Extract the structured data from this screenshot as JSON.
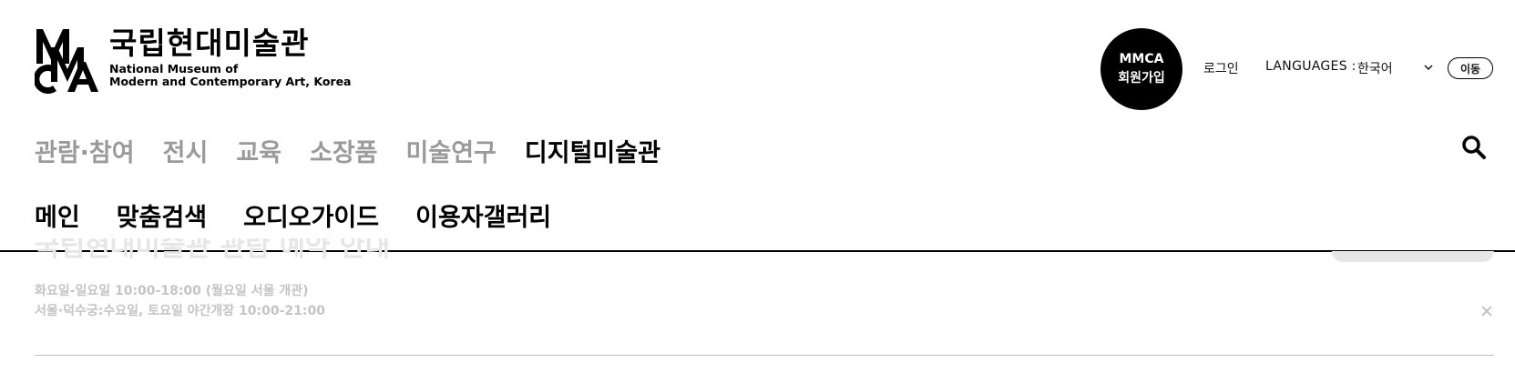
{
  "logo": {
    "korean_name": "국립현대미술관",
    "english_line1": "National Museum of",
    "english_line2": "Modern and Contemporary Art, Korea"
  },
  "header": {
    "join_line1": "MMCA",
    "join_line2": "회원가입",
    "login": "로그인",
    "languages_label": "LANGUAGES :",
    "language_selected": "한국어",
    "go_button": "이동"
  },
  "main_nav": [
    {
      "label": "관람·참여",
      "active": false
    },
    {
      "label": "전시",
      "active": false
    },
    {
      "label": "교육",
      "active": false
    },
    {
      "label": "소장품",
      "active": false
    },
    {
      "label": "미술연구",
      "active": false
    },
    {
      "label": "디지털미술관",
      "active": true
    }
  ],
  "sub_nav": [
    "메인",
    "맞춤검색",
    "오디오가이드",
    "이용자갤러리"
  ],
  "notice": {
    "headline_fragment": "국립현대미술관 관람 예약 안내",
    "hours_line1": "화요일-일요일 10:00-18:00 (월요일 서울 개관)",
    "hours_line2": "서울·덕수궁:수요일, 토요일 야간개장 10:00-21:00"
  },
  "icons": {
    "search": "search-icon",
    "chevron": "chevron-down-icon",
    "close": "close-icon"
  },
  "colors": {
    "inactive_nav": "#9a9a9a",
    "active_nav": "#000000",
    "faded_text": "#c4c4c4"
  }
}
